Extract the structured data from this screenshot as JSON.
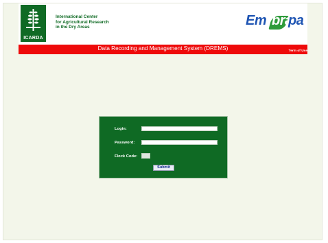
{
  "header": {
    "icarda_logo_text": "ICARDA",
    "org_name_lines": [
      "International Center",
      "for Agricultural Research",
      "in the Dry Areas"
    ],
    "partner_logo": {
      "part1": "Em",
      "part2": "bra",
      "part3": "pa"
    }
  },
  "banner": {
    "title": "Data Recording and Management System (DREMS)",
    "terms_link": "Term of Use"
  },
  "login": {
    "login_label": "Login:",
    "password_label": "Password:",
    "flock_code_label": "Flock Code:",
    "flock_code_value": "",
    "login_value": "",
    "password_value": "",
    "submit_label": "Submit"
  },
  "colors": {
    "icarda_green": "#0f6a24",
    "banner_red": "#ee0a0a",
    "embrapa_blue": "#1f55b3",
    "embrapa_green": "#2e9b3a",
    "page_background": "#f3f6ea"
  }
}
